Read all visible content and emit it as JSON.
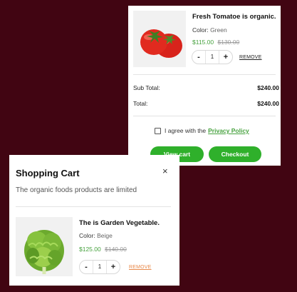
{
  "cart_back": {
    "item": {
      "name": "Fresh Tomatoe is organic.",
      "color_label": "Color:",
      "color_value": "Green",
      "price_now": "$115.00",
      "price_old": "$130.00",
      "quantity": "1",
      "minus": "-",
      "plus": "+",
      "remove_label": "REMOVE",
      "remove_color": "#222222"
    },
    "subtotal_label": "Sub Total:",
    "subtotal_value": "$240.00",
    "total_label": "Total:",
    "total_value": "$240.00",
    "agree_text": "I agree with the",
    "privacy_link": "Privacy Policy",
    "view_cart_label": "View cart",
    "checkout_label": "Checkout"
  },
  "cart_front": {
    "title": "Shopping Cart",
    "close_glyph": "×",
    "subtitle": "The organic foods products are limited",
    "item": {
      "name": "The is Garden Vegetable.",
      "color_label": "Color:",
      "color_value": "Beige",
      "price_now": "$125.00",
      "price_old": "$140.00",
      "quantity": "1",
      "minus": "-",
      "plus": "+",
      "remove_label": "REMOVE",
      "remove_color": "#e8894a"
    }
  },
  "colors": {
    "background": "#410512",
    "accent_green": "#2fb02b",
    "price_green": "#47a23f"
  },
  "icons": [
    "close-icon",
    "checkbox-icon"
  ]
}
